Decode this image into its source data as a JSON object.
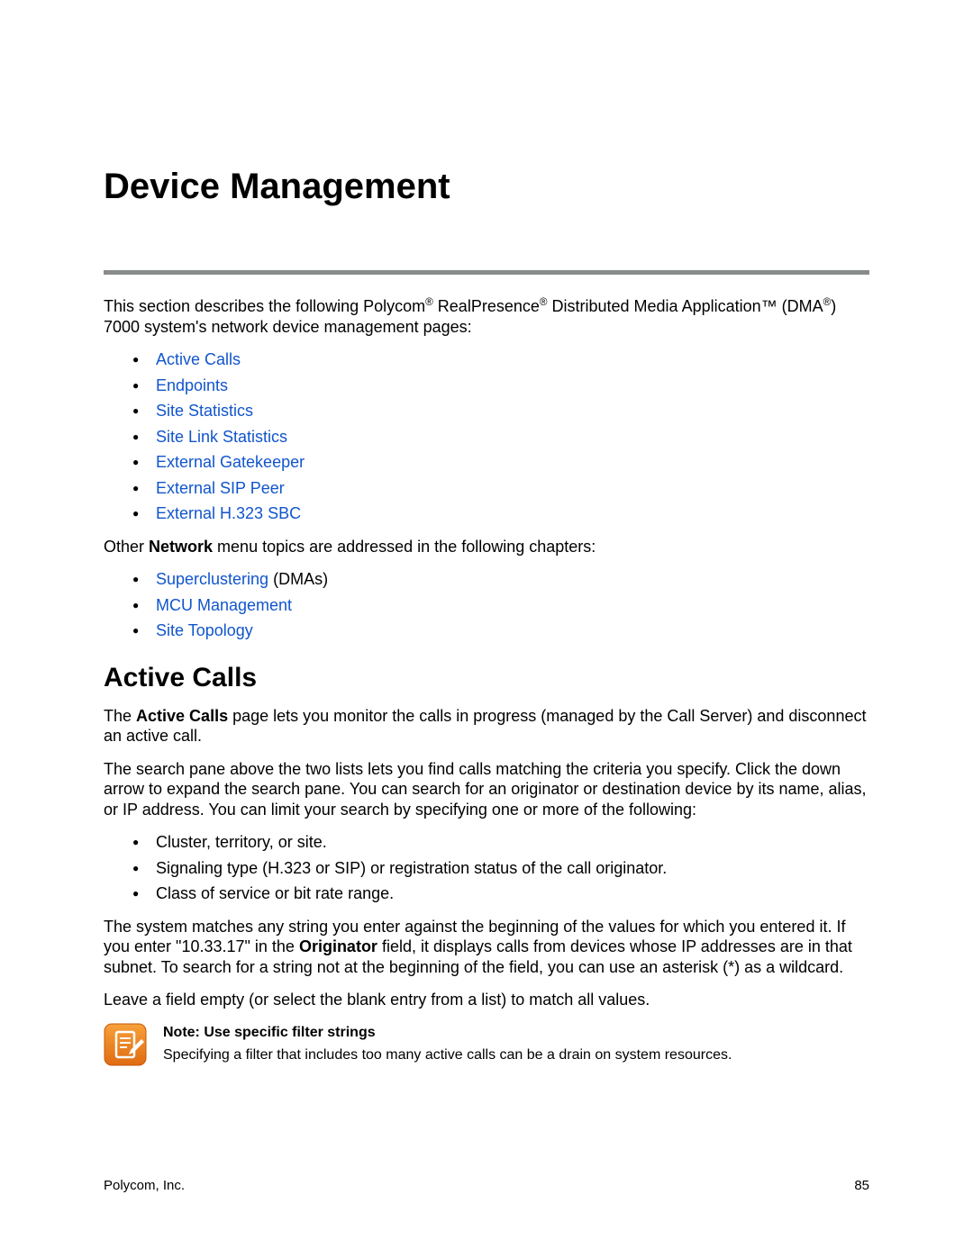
{
  "title": "Device Management",
  "intro": {
    "pre": "This section describes the following Polycom",
    "mid1": " RealPresence",
    "mid2": " Distributed Media Application™ (DMA",
    "post": ") 7000 system's network device management pages:"
  },
  "links1": [
    "Active Calls",
    "Endpoints",
    "Site Statistics",
    "Site Link Statistics",
    "External Gatekeeper",
    "External SIP Peer",
    "External H.323 SBC"
  ],
  "other_pre": "Other ",
  "other_bold": "Network",
  "other_post": " menu topics are addressed in the following chapters:",
  "links2": [
    {
      "link": "Superclustering",
      "after": " (DMAs)"
    },
    {
      "link": "MCU Management",
      "after": ""
    },
    {
      "link": "Site Topology",
      "after": ""
    }
  ],
  "section_heading": "Active Calls",
  "p1": {
    "pre": "The ",
    "bold": "Active Calls",
    "post": " page lets you monitor the calls in progress (managed by the Call Server) and disconnect an active call."
  },
  "p2": "The search pane above the two lists lets you find calls matching the criteria you specify. Click the down arrow to expand the search pane. You can search for an originator or destination device by its name, alias, or IP address. You can limit your search by specifying one or more of the following:",
  "search_bullets": [
    "Cluster, territory, or site.",
    "Signaling type (H.323 or SIP) or registration status of the call originator.",
    "Class of service or bit rate range."
  ],
  "p3": {
    "pre": "The system matches any string you enter against the beginning of the values for which you entered it. If you enter \"10.33.17\" in the ",
    "bold": "Originator",
    "post": " field, it displays calls from devices whose IP addresses are in that subnet. To search for a string not at the beginning of the field, you can use an asterisk (*) as a wildcard."
  },
  "p4": "Leave a field empty (or select the blank entry from a list) to match all values.",
  "note": {
    "title": "Note: Use specific filter strings",
    "body": "Specifying a filter that includes too many active calls can be a drain on system resources."
  },
  "footer_left": "Polycom, Inc.",
  "footer_right": "85"
}
